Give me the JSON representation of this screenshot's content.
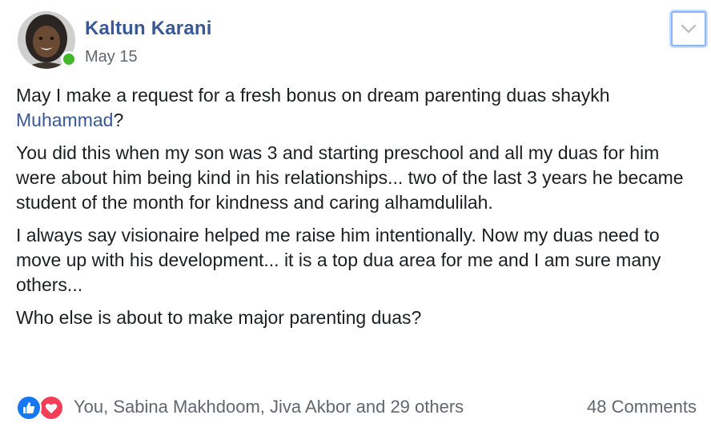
{
  "author": {
    "name": "Kaltun Karani",
    "date": "May 15",
    "avatar_icon": "user-avatar",
    "online": true
  },
  "menu": {
    "icon": "chevron-down-icon"
  },
  "post": {
    "p1_text": "May I make a request for a fresh bonus on dream parenting duas shaykh ",
    "p1_mention": "Muhammad",
    "p1_end": "?",
    "p2": "You did this when my son was 3 and starting preschool and all my duas for him were about him being kind in his relationships... two of the last 3 years he became student of the month for kindness and caring alhamdulilah.",
    "p3": "I always say visionaire helped me raise him intentionally. Now my duas need to move up with his development... it is a top dua area for me and I am sure many others...",
    "p4": "Who else is about to make major parenting duas?"
  },
  "footer": {
    "reaction_icons": [
      "like-icon",
      "love-icon"
    ],
    "reactors": "You, Sabina Makhdoom, Jiva Akbor and 29 others",
    "comments": "48 Comments"
  },
  "colors": {
    "link": "#385898",
    "muted": "#616770",
    "like": "#1877f2",
    "love": "#f33e58",
    "online": "#42b72a"
  }
}
